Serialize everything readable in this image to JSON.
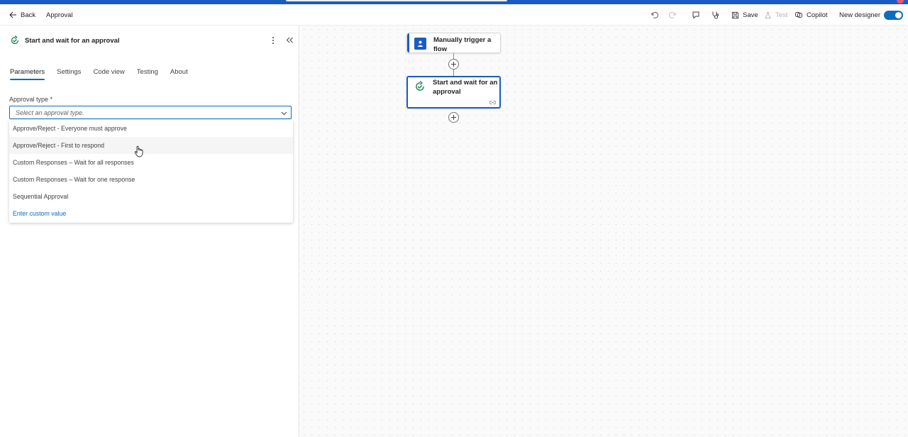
{
  "header": {
    "back_label": "Back",
    "flow_name": "Approval",
    "save_label": "Save",
    "test_label": "Test",
    "copilot_label": "Copilot",
    "new_designer_label": "New designer",
    "new_designer_on": true
  },
  "panel": {
    "title": "Start and wait for an approval",
    "tabs": [
      {
        "label": "Parameters",
        "active": true
      },
      {
        "label": "Settings",
        "active": false
      },
      {
        "label": "Code view",
        "active": false
      },
      {
        "label": "Testing",
        "active": false
      },
      {
        "label": "About",
        "active": false
      }
    ],
    "approval_type": {
      "label": "Approval type *",
      "placeholder": "Select an approval type.",
      "options": [
        "Approve/Reject - Everyone must approve",
        "Approve/Reject - First to respond",
        "Custom Responses – Wait for all responses",
        "Custom Responses – Wait for one response",
        "Sequential Approval"
      ],
      "custom_value_label": "Enter custom value",
      "hovered_option": "Approve/Reject - First to respond"
    }
  },
  "canvas": {
    "nodes": [
      {
        "title": "Manually trigger a flow",
        "icon": "user-trigger-icon",
        "selected": false
      },
      {
        "title": "Start and wait for an approval",
        "icon": "approval-icon",
        "selected": true
      }
    ]
  },
  "colors": {
    "accent": "#0f6cbd",
    "brand_bar": "#1a5bc4"
  }
}
